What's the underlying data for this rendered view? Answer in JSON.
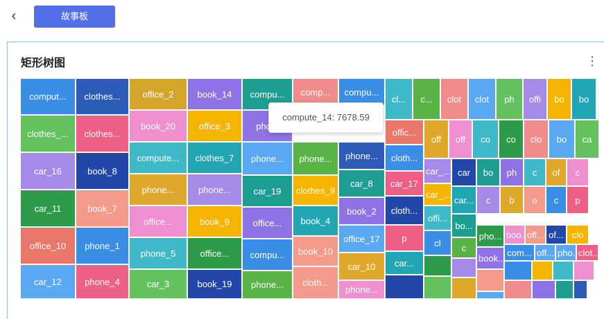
{
  "topbar": {
    "back_icon": "chevron-left-icon",
    "story_button_label": "故事板"
  },
  "panel": {
    "title": "矩形树图",
    "menu_icon": "more-vertical-icon"
  },
  "tooltip": {
    "text": "compute_14: 7678.59"
  },
  "colors": {
    "blue": "#3a8ee6",
    "dblue": "#2c5bb8",
    "green": "#5ab346",
    "pink": "#ed5f84",
    "purple": "#8e72e6",
    "teal": "#3fb8c8",
    "orange": "#f4b400",
    "lpink": "#ef8fd0",
    "yellow": "#d5a52a",
    "navy": "#2347a8",
    "red": "#e9786a",
    "sky": "#5aa8f2",
    "salmon": "#f39a8a",
    "tealg": "#1e9e93",
    "dgreen": "#2e9b4a",
    "lavender": "#a58ae8",
    "bgreen": "#63c25e",
    "cyan": "#22a6b3",
    "gold": "#e0a82b",
    "rose": "#f08c8c"
  },
  "tiles": [
    {
      "label": "comput...",
      "color": "blue"
    },
    {
      "label": "clothes...",
      "color": "dblue"
    },
    {
      "label": "office_2",
      "color": "yellow"
    },
    {
      "label": "book_14",
      "color": "purple"
    },
    {
      "label": "compu...",
      "color": "tealg"
    },
    {
      "label": "comp...",
      "color": "rose"
    },
    {
      "label": "compu...",
      "color": "blue"
    },
    {
      "label": "clothes_...",
      "color": "bgreen"
    },
    {
      "label": "clothes...",
      "color": "pink"
    },
    {
      "label": "book_20",
      "color": "lpink"
    },
    {
      "label": "office_3",
      "color": "orange"
    },
    {
      "label": "pho...",
      "color": "purple"
    },
    {
      "label": "car_16",
      "color": "lavender"
    },
    {
      "label": "book_8",
      "color": "navy"
    },
    {
      "label": "compute...",
      "color": "teal"
    },
    {
      "label": "clothes_7",
      "color": "cyan"
    },
    {
      "label": "phone...",
      "color": "sky"
    },
    {
      "label": "phone...",
      "color": "green"
    },
    {
      "label": "phone...",
      "color": "dblue"
    },
    {
      "label": "car_11",
      "color": "dgreen"
    },
    {
      "label": "book_7",
      "color": "salmon"
    },
    {
      "label": "phone...",
      "color": "gold"
    },
    {
      "label": "phone...",
      "color": "lavender"
    },
    {
      "label": "car_19",
      "color": "tealg"
    },
    {
      "label": "clothes_9",
      "color": "orange"
    },
    {
      "label": "car_8",
      "color": "tealg"
    },
    {
      "label": "office_10",
      "color": "red"
    },
    {
      "label": "phone_1",
      "color": "blue"
    },
    {
      "label": "office...",
      "color": "lpink"
    },
    {
      "label": "book_9",
      "color": "orange"
    },
    {
      "label": "office...",
      "color": "purple"
    },
    {
      "label": "book_4",
      "color": "cyan"
    },
    {
      "label": "book_2",
      "color": "purple"
    },
    {
      "label": "car_12",
      "color": "sky"
    },
    {
      "label": "phone_4",
      "color": "pink"
    },
    {
      "label": "phone_5",
      "color": "teal"
    },
    {
      "label": "office...",
      "color": "dgreen"
    },
    {
      "label": "compu...",
      "color": "blue"
    },
    {
      "label": "book_10",
      "color": "salmon"
    },
    {
      "label": "office_17",
      "color": "sky"
    },
    {
      "label": "car_3",
      "color": "bgreen"
    },
    {
      "label": "book_19",
      "color": "navy"
    },
    {
      "label": "phone...",
      "color": "green"
    },
    {
      "label": "cloth...",
      "color": "salmon"
    },
    {
      "label": "car_10",
      "color": "gold"
    },
    {
      "label": "phone...",
      "color": "lpink"
    },
    {
      "label": "cl...",
      "color": "teal"
    },
    {
      "label": "c...",
      "color": "green"
    },
    {
      "label": "clot",
      "color": "rose"
    },
    {
      "label": "clot",
      "color": "sky"
    },
    {
      "label": "ph",
      "color": "bgreen"
    },
    {
      "label": "offi",
      "color": "lavender"
    },
    {
      "label": "bo",
      "color": "orange"
    },
    {
      "label": "bo",
      "color": "cyan"
    },
    {
      "label": "offic...",
      "color": "red"
    },
    {
      "label": "off",
      "color": "gold"
    },
    {
      "label": "off",
      "color": "lpink"
    },
    {
      "label": "co",
      "color": "teal"
    },
    {
      "label": "co",
      "color": "dgreen"
    },
    {
      "label": "clo",
      "color": "rose"
    },
    {
      "label": "bo",
      "color": "sky"
    },
    {
      "label": "ca",
      "color": "bgreen"
    },
    {
      "label": "cloth...",
      "color": "blue"
    },
    {
      "label": "car_...",
      "color": "lavender"
    },
    {
      "label": "car",
      "color": "navy"
    },
    {
      "label": "bo",
      "color": "tealg"
    },
    {
      "label": "ph",
      "color": "purple"
    },
    {
      "label": "c",
      "color": "teal"
    },
    {
      "label": "of",
      "color": "gold"
    },
    {
      "label": "c",
      "color": "lpink"
    },
    {
      "label": "car_17",
      "color": "pink"
    },
    {
      "label": "car_...",
      "color": "orange"
    },
    {
      "label": "car...",
      "color": "cyan"
    },
    {
      "label": "c",
      "color": "lavender"
    },
    {
      "label": "b",
      "color": "gold"
    },
    {
      "label": "o",
      "color": "salmon"
    },
    {
      "label": "c",
      "color": "blue"
    },
    {
      "label": "p",
      "color": "pink"
    },
    {
      "label": "cloth...",
      "color": "navy"
    },
    {
      "label": "offi...",
      "color": "teal"
    },
    {
      "label": "bo...",
      "color": "tealg"
    },
    {
      "label": "pho...",
      "color": "dgreen"
    },
    {
      "label": "boo...",
      "color": "lpink"
    },
    {
      "label": "off...",
      "color": "salmon"
    },
    {
      "label": "of...",
      "color": "navy"
    },
    {
      "label": "clo",
      "color": "orange"
    },
    {
      "label": "p",
      "color": "pink"
    },
    {
      "label": "cl",
      "color": "blue"
    },
    {
      "label": "c",
      "color": "green"
    },
    {
      "label": "book...",
      "color": "purple"
    },
    {
      "label": "com...",
      "color": "blue"
    },
    {
      "label": "off...",
      "color": "sky"
    },
    {
      "label": "pho...",
      "color": "sky"
    },
    {
      "label": "clot...",
      "color": "pink"
    },
    {
      "label": "car...",
      "color": "cyan"
    },
    {
      "label": "",
      "color": "dgreen"
    },
    {
      "label": "",
      "color": "lavender"
    },
    {
      "label": "",
      "color": "salmon"
    },
    {
      "label": "",
      "color": "blue"
    },
    {
      "label": "",
      "color": "orange"
    },
    {
      "label": "",
      "color": "teal"
    },
    {
      "label": "",
      "color": "lpink"
    },
    {
      "label": "",
      "color": "navy"
    },
    {
      "label": "",
      "color": "bgreen"
    },
    {
      "label": "",
      "color": "gold"
    },
    {
      "label": "",
      "color": "sky"
    },
    {
      "label": "",
      "color": "rose"
    },
    {
      "label": "",
      "color": "purple"
    },
    {
      "label": "",
      "color": "tealg"
    },
    {
      "label": "",
      "color": "dblue"
    }
  ]
}
